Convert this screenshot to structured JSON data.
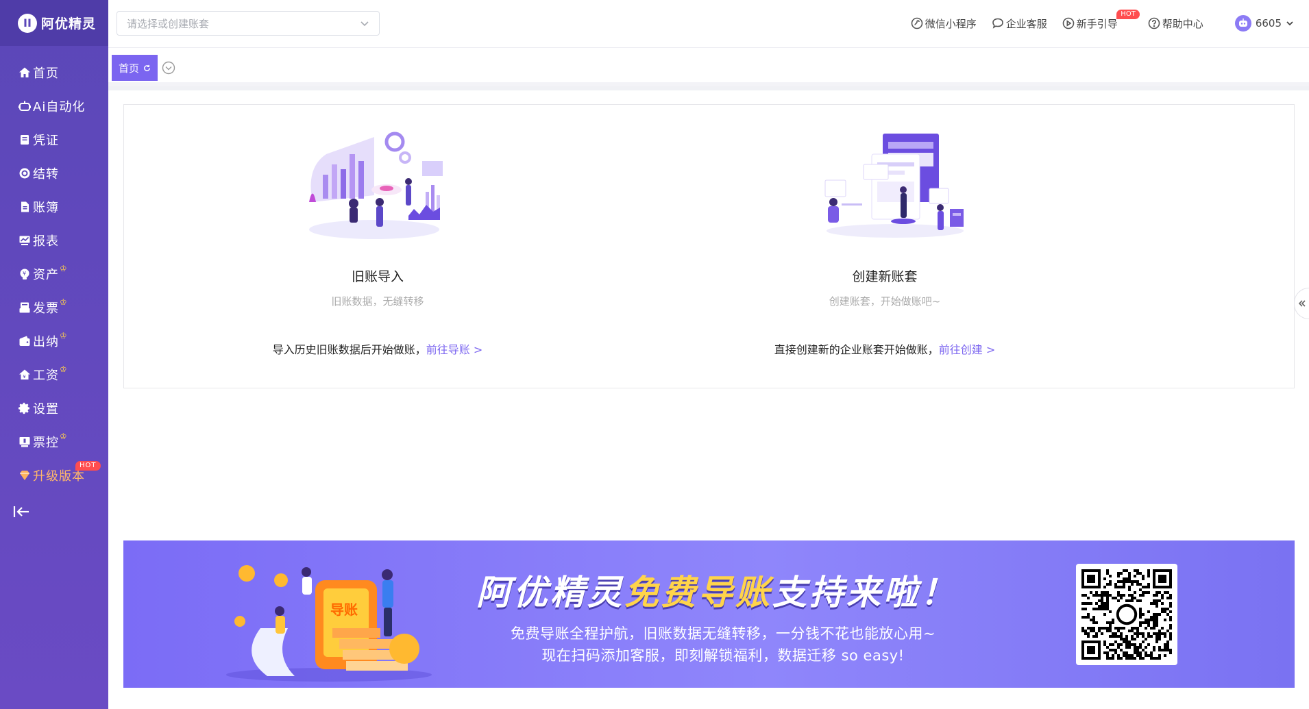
{
  "app": {
    "logo_mark": "II",
    "logo_text": "阿优精灵"
  },
  "sidebar": {
    "items": [
      {
        "label": "首页",
        "icon": "home-icon",
        "crown": false
      },
      {
        "label": "Ai自动化",
        "icon": "robot-icon",
        "crown": false
      },
      {
        "label": "凭证",
        "icon": "voucher-icon",
        "crown": false
      },
      {
        "label": "结转",
        "icon": "carryover-icon",
        "crown": false
      },
      {
        "label": "账簿",
        "icon": "ledger-icon",
        "crown": false
      },
      {
        "label": "报表",
        "icon": "report-icon",
        "crown": false
      },
      {
        "label": "资产",
        "icon": "asset-icon",
        "crown": true
      },
      {
        "label": "发票",
        "icon": "invoice-icon",
        "crown": true
      },
      {
        "label": "出纳",
        "icon": "wallet-icon",
        "crown": true
      },
      {
        "label": "工资",
        "icon": "salary-icon",
        "crown": true
      },
      {
        "label": "设置",
        "icon": "gear-icon",
        "crown": false
      },
      {
        "label": "票控",
        "icon": "ticket-control-icon",
        "crown": true
      }
    ],
    "upgrade": {
      "label": "升级版本",
      "badge": "HOT"
    },
    "crown_glyph": "♔"
  },
  "topbar": {
    "account_placeholder": "请选择或创建账套",
    "links": [
      {
        "label": "微信小程序",
        "icon": "mini-program-icon"
      },
      {
        "label": "企业客服",
        "icon": "customer-service-icon"
      },
      {
        "label": "新手引导",
        "icon": "play-icon",
        "badge": "HOT"
      },
      {
        "label": "帮助中心",
        "icon": "help-icon"
      }
    ],
    "user_id": "6605"
  },
  "tabs": {
    "home_label": "首页"
  },
  "cards": [
    {
      "title": "旧账导入",
      "subtitle": "旧账数据，无缝转移",
      "desc": "导入历史旧账数据后开始做账，",
      "link": "前往导账 >"
    },
    {
      "title": "创建新账套",
      "subtitle": "创建账套，开始做账吧~",
      "desc": "直接创建新的企业账套开始做账，",
      "link": "前往创建 >"
    }
  ],
  "banner": {
    "title_a": "阿优精灵",
    "title_b": "免费导账",
    "title_c": "支持来啦！",
    "line1": "免费导账全程护航，旧账数据无缝转移，一分钱不花也能放心用~",
    "line2": "现在扫码添加客服，即刻解锁福利，数据迁移 so easy!",
    "card_text": "导账"
  },
  "colors": {
    "sidebar": "#5b47b8",
    "accent": "#7b65f0",
    "hot": "#ff4d4f",
    "crown": "#ffcf4a"
  }
}
